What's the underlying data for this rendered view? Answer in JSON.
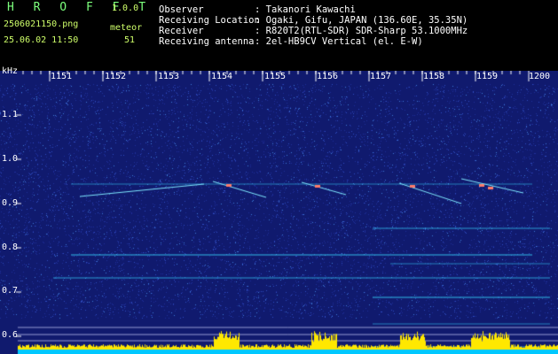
{
  "header": {
    "app_name": "H R O F F T",
    "version": "1.0.0",
    "file_name": "2506021150.png",
    "timestamp": "25.06.02 11:50",
    "meteor_label": "meteor",
    "meteor_count": "51",
    "info": [
      {
        "label": "Observer",
        "value": ": Takanori Kawachi"
      },
      {
        "label": "Receiving Location",
        "value": ": Ogaki, Gifu, JAPAN (136.60E, 35.35N)"
      },
      {
        "label": "Receiver",
        "value": ": R820T2(RTL-SDR) SDR-Sharp 53.1000MHz"
      },
      {
        "label": "Receiving antenna",
        "value": ": 2el-HB9CV Vertical (el. E-W)"
      }
    ]
  },
  "spectrogram": {
    "y_unit": "kHz",
    "time_ticks": [
      "1151",
      "1152",
      "1153",
      "1154",
      "1155",
      "1156",
      "1157",
      "1158",
      "1159",
      "1200"
    ],
    "freq_ticks": [
      "1.1",
      "1.0",
      "0.9",
      "0.8",
      "0.7",
      "0.6"
    ],
    "colors": {
      "background": "#101a6e",
      "trace": "#37d7ff",
      "hot": "#ff7a6a",
      "activity": "#ffe800",
      "baseline": "#00c8ff"
    }
  }
}
